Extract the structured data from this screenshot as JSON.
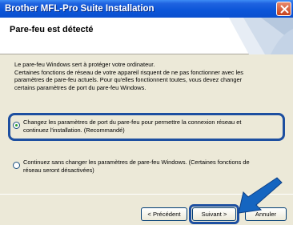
{
  "window": {
    "title": "Brother MFL-Pro Suite Installation"
  },
  "header": {
    "title": "Pare-feu est détecté"
  },
  "body": {
    "line1": "Le pare-feu Windows sert à protéger votre ordinateur.",
    "line2": "Certaines fonctions de réseau de votre appareil risquent de ne pas fonctionner avec les",
    "line3": "paramètres de pare-feu actuels. Pour qu'elles fonctionnent toutes, vous devez changer",
    "line4": "certains paramètres de port du pare-feu Windows."
  },
  "options": [
    {
      "line1": "Changez les paramètres de port du pare-feu pour permettre la connexion réseau et",
      "line2": "continuez l'installation. (Recommandé)",
      "selected": true
    },
    {
      "line1": "Continuez sans changer les paramètres de pare-feu Windows. (Certaines fonctions de",
      "line2": "réseau seront désactivées)",
      "selected": false
    }
  ],
  "buttons": {
    "back": "< Précédent",
    "next": "Suivant >",
    "cancel": "Annuler"
  },
  "colors": {
    "titlebar": "#0b55d8",
    "highlight": "#1d4fa0",
    "arrow": "#1565c0"
  },
  "icons": {
    "close": "close-icon",
    "arrow": "pointer-arrow-icon"
  }
}
